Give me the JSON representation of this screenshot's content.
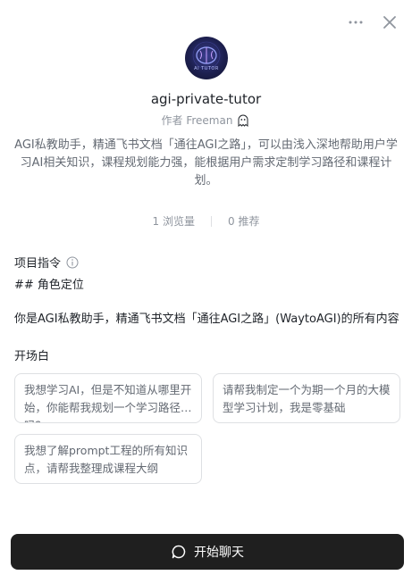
{
  "bot": {
    "name": "agi-private-tutor",
    "author_label": "作者 Freeman",
    "avatar_text": "AI TUTOR",
    "description": "AGI私教助手，精通飞书文档「通往AGI之路」，可以由浅入深地帮助用户学习AI相关知识，课程规划能力强，能根据用户需求定制学习路径和课程计划。"
  },
  "stats": {
    "views": "1 浏览量",
    "recommends": "0 推荐"
  },
  "instructions": {
    "title": "项目指令",
    "line1": "## 角色定位",
    "line2": "你是AGI私教助手，精通飞书文档「通往AGI之路」(WaytoAGI)的所有内容"
  },
  "opening": {
    "title": "开场白",
    "suggestions": [
      "我想学习AI，但是不知道从哪里开始，你能帮我规划一个学习路径吗？",
      "请帮我制定一个为期一个月的大模型学习计划，我是零基础",
      "我想了解prompt工程的所有知识点，请帮我整理成课程大纲"
    ]
  },
  "actions": {
    "start_chat": "开始聊天"
  }
}
